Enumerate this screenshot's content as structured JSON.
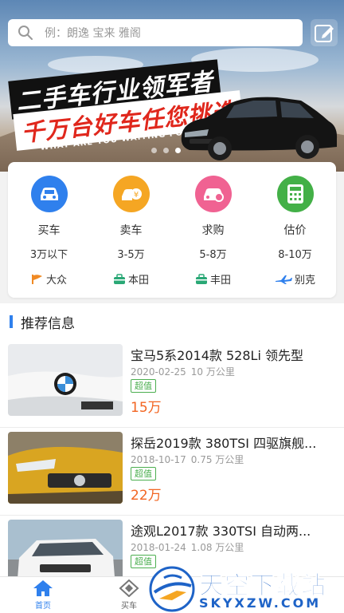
{
  "search": {
    "placeholder": "例：朗逸 宝来 雅阁"
  },
  "banner": {
    "line1": "二手车行业领军者",
    "line2": "千万台好车任您挑选",
    "line3": "WHAT ARE YOU WAITING FOR"
  },
  "categories": [
    {
      "label": "买车",
      "icon": "car-buy-icon",
      "color": "#2f80ed"
    },
    {
      "label": "卖车",
      "icon": "car-sell-icon",
      "color": "#f5a623"
    },
    {
      "label": "求购",
      "icon": "car-wanted-icon",
      "color": "#f06292"
    },
    {
      "label": "估价",
      "icon": "calculator-icon",
      "color": "#43b047"
    }
  ],
  "price_ranges": [
    "3万以下",
    "3-5万",
    "5-8万",
    "8-10万"
  ],
  "brands": [
    {
      "label": "大众",
      "icon": "flag-icon"
    },
    {
      "label": "本田",
      "icon": "briefcase-icon"
    },
    {
      "label": "丰田",
      "icon": "briefcase-icon"
    },
    {
      "label": "别克",
      "icon": "plane-icon"
    }
  ],
  "section": {
    "title": "推荐信息"
  },
  "listings": [
    {
      "title": "宝马5系2014款 528Li 领先型",
      "date": "2020-02-25",
      "mileage": "10 万公里",
      "tag": "超值",
      "price": "15万"
    },
    {
      "title": "探岳2019款 380TSI 四驱旗舰...",
      "date": "2018-10-17",
      "mileage": "0.75 万公里",
      "tag": "超值",
      "price": "22万"
    },
    {
      "title": "途观L2017款 330TSI 自动两...",
      "date": "2018-01-24",
      "mileage": "1.08 万公里",
      "tag": "超值",
      "price": ""
    }
  ],
  "nav": [
    {
      "label": "首页",
      "icon": "home-icon"
    },
    {
      "label": "买车",
      "icon": "diamond-icon"
    }
  ],
  "watermark": {
    "text": "天空下载站",
    "sub": "SKYXZW.COM"
  },
  "colors": {
    "accent": "#2f80ed",
    "price": "#f26522",
    "tag": "#4caf50"
  }
}
